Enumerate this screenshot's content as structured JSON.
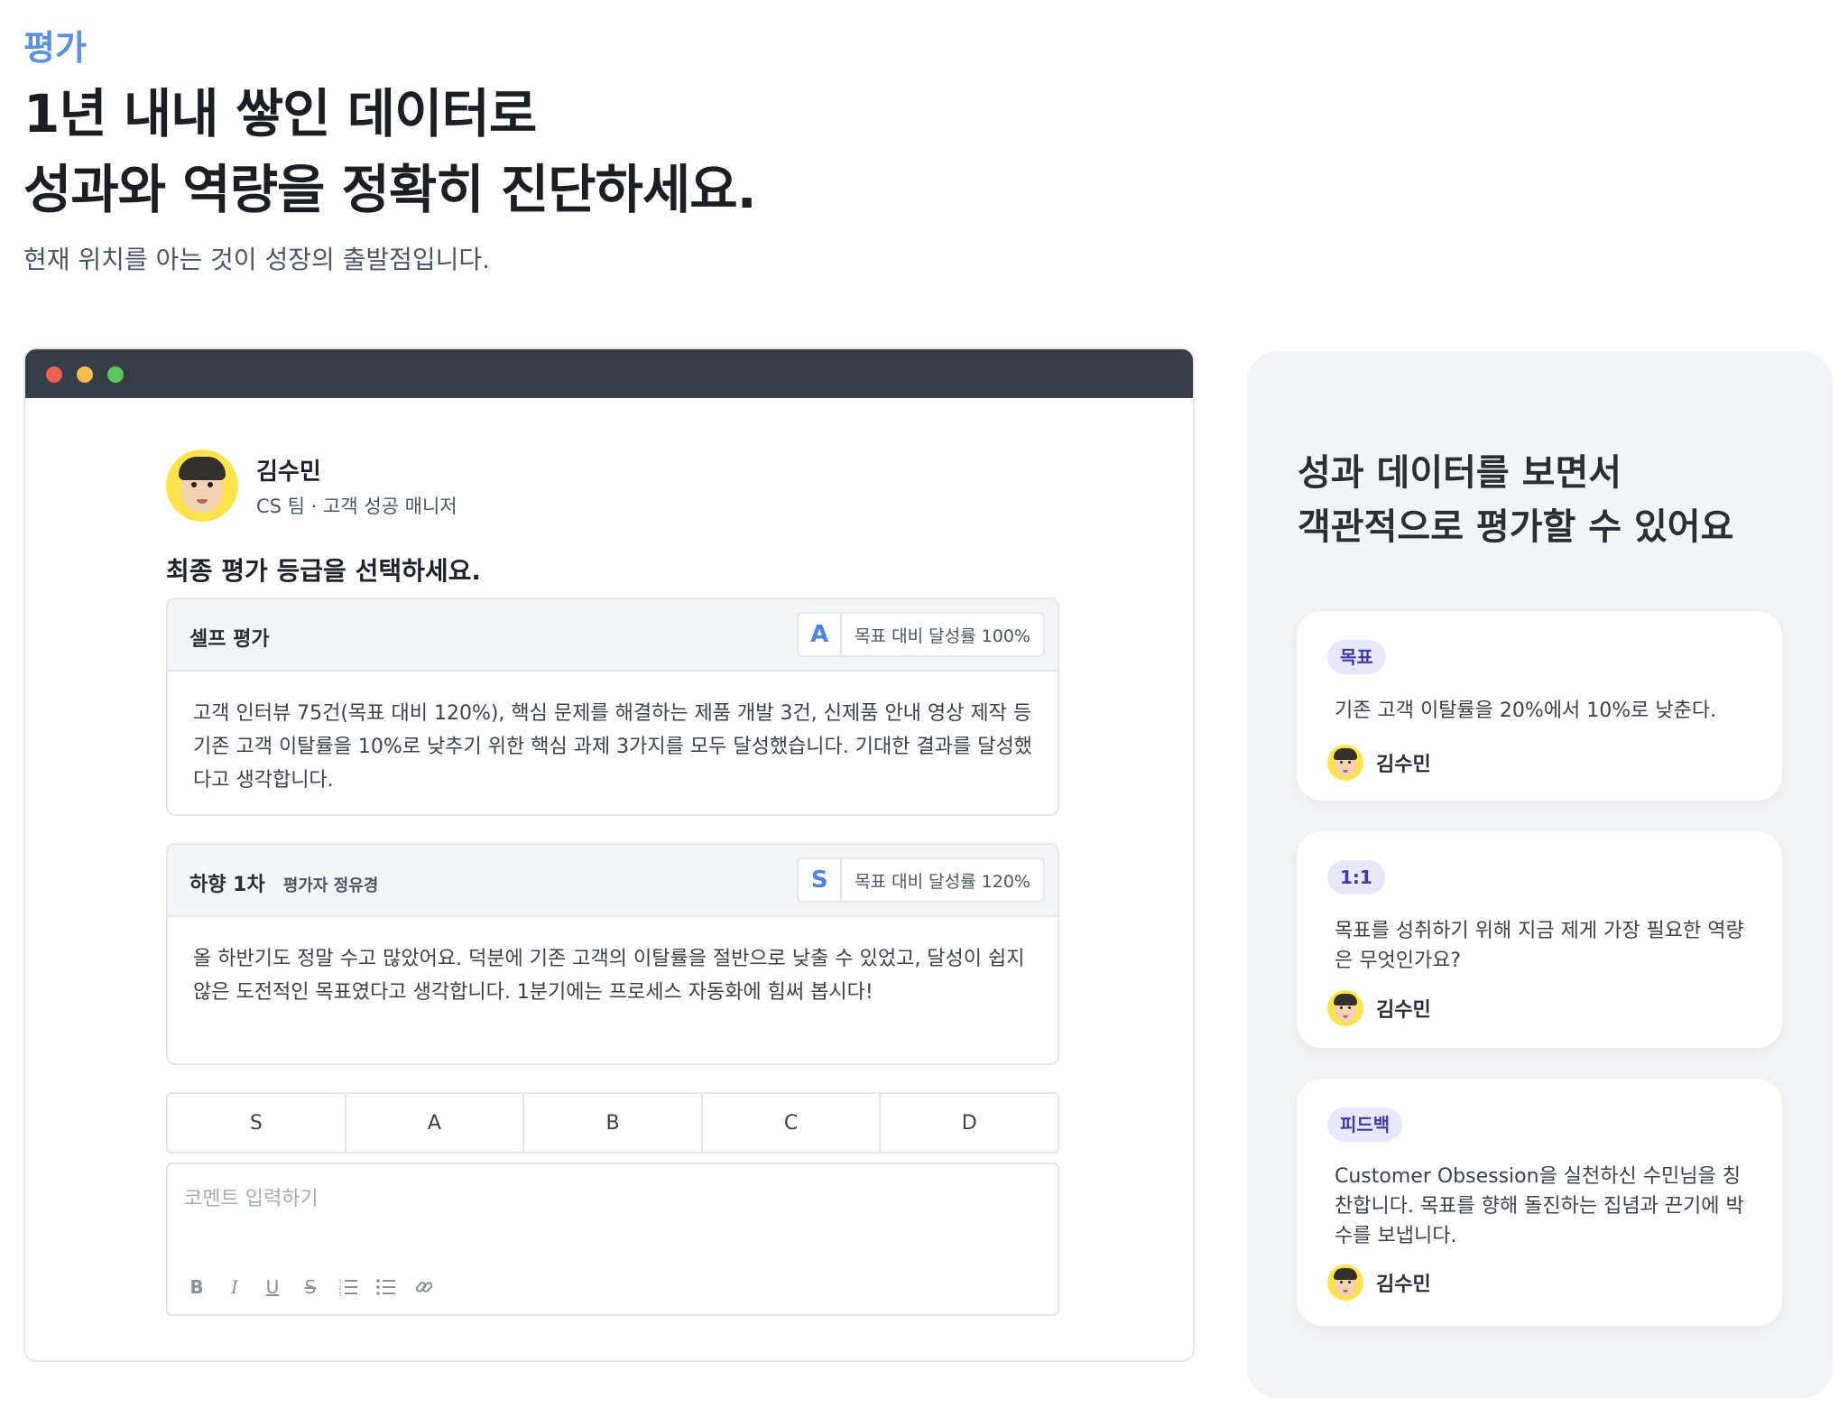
{
  "header": {
    "section_label": "평가",
    "headline_line1": "1년 내내 쌓인 데이터로",
    "headline_line2": "성과와 역량을 정확히 진단하세요.",
    "subline": "현재 위치를 아는 것이 성장의 출발점입니다."
  },
  "window": {
    "profile": {
      "name": "김수민",
      "role": "CS 팀 · 고객 성공 매니저"
    },
    "prompt": "최종 평가 등급을 선택하세요.",
    "self_eval": {
      "title": "셀프 평가",
      "grade": "A",
      "achievement": "목표 대비 달성률 100%",
      "body": "고객 인터뷰 75건(목표 대비 120%), 핵심 문제를 해결하는 제품 개발 3건, 신제품 안내 영상 제작 등 기존 고객 이탈률을 10%로 낮추기 위한 핵심 과제 3가지를 모두 달성했습니다. 기대한 결과를 달성했다고 생각합니다."
    },
    "downward_eval": {
      "title": "하향 1차",
      "evaluator": "평가자 정유경",
      "grade": "S",
      "achievement": "목표 대비 달성률 120%",
      "body": "올 하반기도 정말 수고 많았어요. 덕분에 기존 고객의 이탈률을 절반으로 낮출 수 있었고, 달성이 쉽지 않은 도전적인 목표였다고 생각합니다. 1분기에는 프로세스 자동화에 힘써 봅시다!"
    },
    "grade_options": [
      "S",
      "A",
      "B",
      "C",
      "D"
    ],
    "comment_placeholder": "코멘트 입력하기",
    "toolbar": {
      "bold": "B",
      "italic": "I",
      "underline": "U",
      "strike": "S",
      "ordered_list": "⁝≡",
      "bullet_list": "⁝≡",
      "link": "🔗"
    }
  },
  "panel": {
    "title_line1": "성과 데이터를 보면서",
    "title_line2": "객관적으로 평가할 수 있어요",
    "cards": [
      {
        "tag": "목표",
        "text": "기존 고객 이탈률을 20%에서 10%로 낮춘다.",
        "author": "김수민"
      },
      {
        "tag": "1:1",
        "text": "목표를 성취하기 위해 지금 제게 가장 필요한 역량은 무엇인가요?",
        "author": "김수민"
      },
      {
        "tag": "피드백",
        "text": "Customer Obsession을 실천하신 수민님을 칭찬합니다. 목표를 향해 돌진하는 집념과 끈기에 박수를 보냅니다.",
        "author": "김수민"
      }
    ]
  },
  "colors": {
    "accent": "#5b8fe0",
    "titlebar": "#363d47",
    "tag_bg": "#e9e8fb",
    "tag_text": "#4338a8"
  }
}
